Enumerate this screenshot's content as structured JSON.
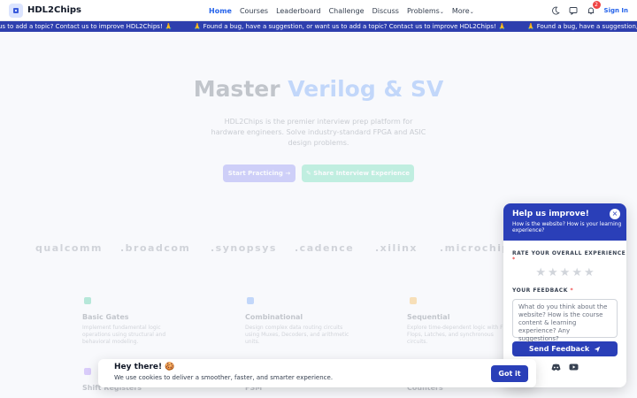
{
  "brand": {
    "name": "HDL2Chips",
    "logo_icon": "chip-icon",
    "accent": "#2563eb"
  },
  "nav": {
    "links": [
      "Home",
      "Courses",
      "Leaderboard",
      "Challenge",
      "Discuss",
      "Problems",
      "More"
    ],
    "active": "Home",
    "notifications": "2",
    "signin": "Sign In"
  },
  "banner": {
    "message": "Found a bug, have a suggestion, or want us to add a topic? Contact us to improve HDL2Chips!",
    "partial_start": "us to add a topic? Contact us to improve HDL2Chips! 🙏",
    "bg": "#2e3fae"
  },
  "hero": {
    "title_plain": "Master ",
    "title_highlight": "Verilog & SV",
    "subtitle": "HDL2Chips is the premier interview prep platform for hardware engineers. Solve industry-standard FPGA and ASIC design problems.",
    "btn_practice": "Start Practicing →",
    "btn_share": "✎ Share Interview Experience"
  },
  "companies": [
    "qualcomm",
    ".broadcom",
    ".synopsys",
    ".cadence",
    ".xilinx",
    ".microchip"
  ],
  "cards": [
    {
      "title": "Basic Gates",
      "desc": "Implement fundamental logic operations using structural and behavioral modeling."
    },
    {
      "title": "Combinational",
      "desc": "Design complex data routing circuits using Muxes, Decoders, and arithmetic units."
    },
    {
      "title": "Sequential",
      "desc": "Explore time-dependent logic with Flip Flops, Latches, and synchronous circuits."
    },
    {
      "title": "Shift Registers"
    },
    {
      "title": "FSM"
    },
    {
      "title": "Counters"
    }
  ],
  "feedback": {
    "title": "Help us improve!",
    "subtitle": "How is the website? How is your learning experience?",
    "rate_label": "RATE YOUR OVERALL EXPERIENCE",
    "stars": [
      "★",
      "★",
      "★",
      "★",
      "★"
    ],
    "feedback_label": "YOUR FEEDBACK",
    "placeholder": "What do you think about the website? How is the course content & learning experience? Any suggestions?",
    "send": "Send Feedback",
    "close": "×"
  },
  "cookie": {
    "title": "Hey there! 🍪",
    "text": "We use cookies to deliver a smoother, faster, and smarter experience.",
    "button": "Got it"
  }
}
